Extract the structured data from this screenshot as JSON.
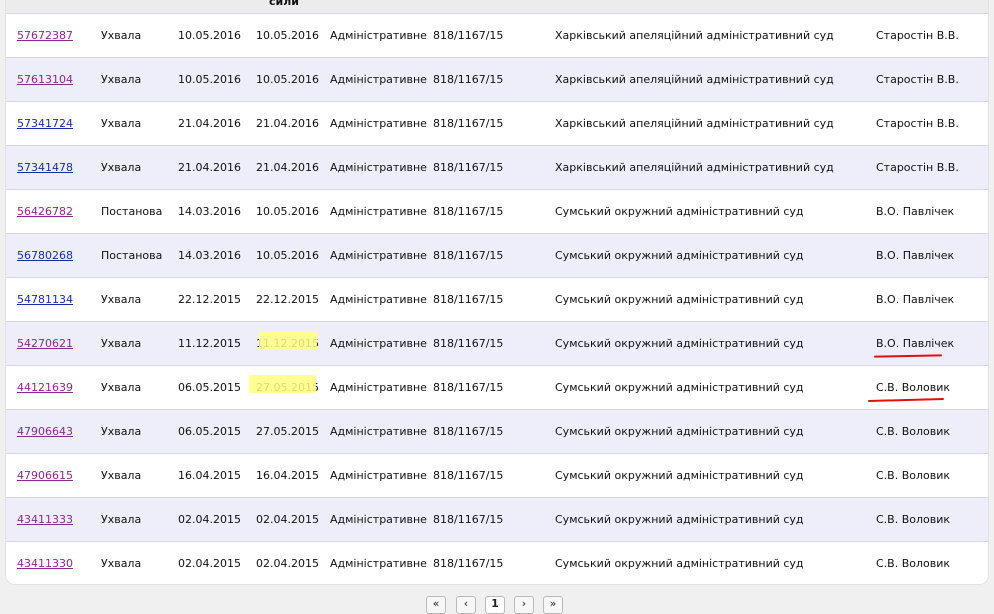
{
  "header": {
    "date_label_fragment": "сили"
  },
  "rows": [
    {
      "id": "57672387",
      "type": "Ухвала",
      "reg_date": "10.05.2016",
      "effective_date": "10.05.2016",
      "form": "Адміністративне",
      "case_no": "818/1167/15",
      "court": "Харківський апеляційний адміністративний суд",
      "judge": "Старостін В.В.",
      "visited": true
    },
    {
      "id": "57613104",
      "type": "Ухвала",
      "reg_date": "10.05.2016",
      "effective_date": "10.05.2016",
      "form": "Адміністративне",
      "case_no": "818/1167/15",
      "court": "Харківський апеляційний адміністративний суд",
      "judge": "Старостін В.В.",
      "visited": true
    },
    {
      "id": "57341724",
      "type": "Ухвала",
      "reg_date": "21.04.2016",
      "effective_date": "21.04.2016",
      "form": "Адміністративне",
      "case_no": "818/1167/15",
      "court": "Харківський апеляційний адміністративний суд",
      "judge": "Старостін В.В.",
      "visited": false
    },
    {
      "id": "57341478",
      "type": "Ухвала",
      "reg_date": "21.04.2016",
      "effective_date": "21.04.2016",
      "form": "Адміністративне",
      "case_no": "818/1167/15",
      "court": "Харківський апеляційний адміністративний суд",
      "judge": "Старостін В.В.",
      "visited": false
    },
    {
      "id": "56426782",
      "type": "Постанова",
      "reg_date": "14.03.2016",
      "effective_date": "10.05.2016",
      "form": "Адміністративне",
      "case_no": "818/1167/15",
      "court": "Сумський окружний адміністративний суд",
      "judge": "В.О. Павлічек",
      "visited": true
    },
    {
      "id": "56780268",
      "type": "Постанова",
      "reg_date": "14.03.2016",
      "effective_date": "10.05.2016",
      "form": "Адміністративне",
      "case_no": "818/1167/15",
      "court": "Сумський окружний адміністративний суд",
      "judge": "В.О. Павлічек",
      "visited": false
    },
    {
      "id": "54781134",
      "type": "Ухвала",
      "reg_date": "22.12.2015",
      "effective_date": "22.12.2015",
      "form": "Адміністративне",
      "case_no": "818/1167/15",
      "court": "Сумський окружний адміністративний суд",
      "judge": "В.О. Павлічек",
      "visited": false
    },
    {
      "id": "54270621",
      "type": "Ухвала",
      "reg_date": "11.12.2015",
      "effective_date": "11.12.2015",
      "form": "Адміністративне",
      "case_no": "818/1167/15",
      "court": "Сумський окружний адміністративний суд",
      "judge": "В.О. Павлічек",
      "visited": true
    },
    {
      "id": "44121639",
      "type": "Ухвала",
      "reg_date": "06.05.2015",
      "effective_date": "27.05.2015",
      "form": "Адміністративне",
      "case_no": "818/1167/15",
      "court": "Сумський окружний адміністративний суд",
      "judge": "С.В. Воловик",
      "visited": true
    },
    {
      "id": "47906643",
      "type": "Ухвала",
      "reg_date": "06.05.2015",
      "effective_date": "27.05.2015",
      "form": "Адміністративне",
      "case_no": "818/1167/15",
      "court": "Сумський окружний адміністративний суд",
      "judge": "С.В. Воловик",
      "visited": true
    },
    {
      "id": "47906615",
      "type": "Ухвала",
      "reg_date": "16.04.2015",
      "effective_date": "16.04.2015",
      "form": "Адміністративне",
      "case_no": "818/1167/15",
      "court": "Сумський окружний адміністративний суд",
      "judge": "С.В. Воловик",
      "visited": true
    },
    {
      "id": "43411333",
      "type": "Ухвала",
      "reg_date": "02.04.2015",
      "effective_date": "02.04.2015",
      "form": "Адміністративне",
      "case_no": "818/1167/15",
      "court": "Сумський окружний адміністративний суд",
      "judge": "С.В. Воловик",
      "visited": true
    },
    {
      "id": "43411330",
      "type": "Ухвала",
      "reg_date": "02.04.2015",
      "effective_date": "02.04.2015",
      "form": "Адміністративне",
      "case_no": "818/1167/15",
      "court": "Сумський окружний адміністративний суд",
      "judge": "С.В. Воловик",
      "visited": true
    }
  ],
  "pager": {
    "first": "«",
    "prev": "‹",
    "current": "1",
    "next": "›",
    "last": "»"
  },
  "colors": {
    "visited_link": "#8a2a8a",
    "unvisited_link": "#1a2ea0",
    "row_alt": "#eeeefa",
    "highlight": "#ffff80",
    "annotation_red": "#e01010"
  }
}
